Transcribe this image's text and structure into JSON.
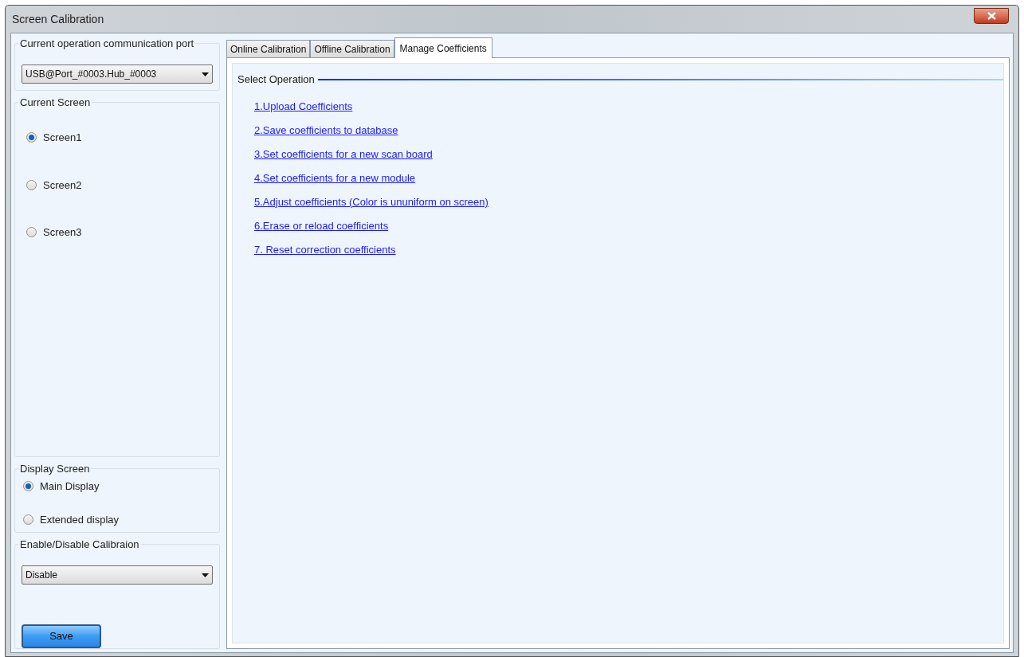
{
  "window": {
    "title": "Screen Calibration"
  },
  "port": {
    "label": "Current operation communication port",
    "value": "USB@Port_#0003.Hub_#0003"
  },
  "current_screen": {
    "label": "Current Screen",
    "options": [
      {
        "label": "Screen1",
        "selected": true
      },
      {
        "label": "Screen2",
        "selected": false
      },
      {
        "label": "Screen3",
        "selected": false
      }
    ]
  },
  "display_screen": {
    "label": "Display Screen",
    "options": [
      {
        "label": "Main Display",
        "selected": true
      },
      {
        "label": "Extended display",
        "selected": false
      }
    ]
  },
  "calibration": {
    "label": "Enable/Disable Calibraion",
    "value": "Disable"
  },
  "save_button": "Save",
  "tabs": [
    {
      "label": "Online Calibration",
      "selected": false
    },
    {
      "label": "Offline Calibration",
      "selected": false
    },
    {
      "label": "Manage Coefficients",
      "selected": true
    }
  ],
  "operations": {
    "label": "Select Operation",
    "links": [
      "1.Upload Coefficients",
      "2.Save coefficients to database",
      "3.Set coefficients for a new scan board",
      "4.Set coefficients for a new module",
      "5.Adjust coefficients (Color is ununiform on screen)",
      "6.Erase or reload coefficients",
      "7. Reset correction coefficients"
    ]
  }
}
